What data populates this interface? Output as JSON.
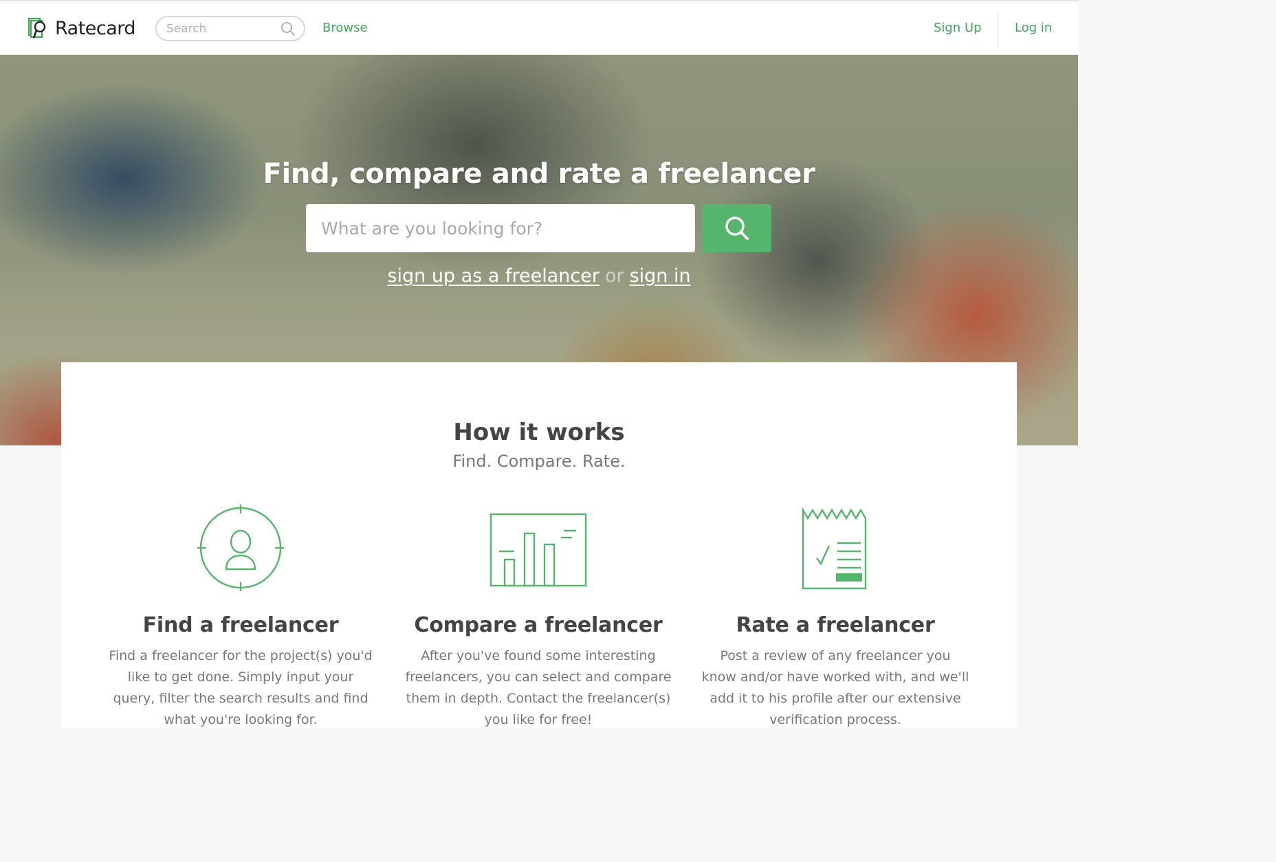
{
  "brand": {
    "name": "Ratecard",
    "accent": "#3ea55a",
    "button_green": "#55b56c"
  },
  "header": {
    "search_placeholder": "Search",
    "browse": "Browse",
    "sign_up": "Sign Up",
    "log_in": "Log in"
  },
  "hero": {
    "title": "Find, compare and rate a freelancer",
    "search_placeholder": "What are you looking for?",
    "search_button_icon": "search-icon",
    "signup_link": "sign up as a freelancer",
    "or": "or",
    "signin_link": "sign in"
  },
  "how_it_works": {
    "title": "How it works",
    "subtitle": "Find. Compare. Rate.",
    "steps": [
      {
        "icon": "target-person-icon",
        "title": "Find a freelancer",
        "text": "Find a freelancer for the project(s) you'd like to get done. Simply input your query, filter the search results and find what you're looking for."
      },
      {
        "icon": "bar-chart-icon",
        "title": "Compare a freelancer",
        "text": "After you've found some interesting freelancers, you can select and compare them in depth. Contact the freelancer(s) you like for free!"
      },
      {
        "icon": "receipt-check-icon",
        "title": "Rate a freelancer",
        "text": "Post a review of any freelancer you know and/or have worked with, and we'll add it to his profile after our extensive verification process."
      }
    ]
  }
}
